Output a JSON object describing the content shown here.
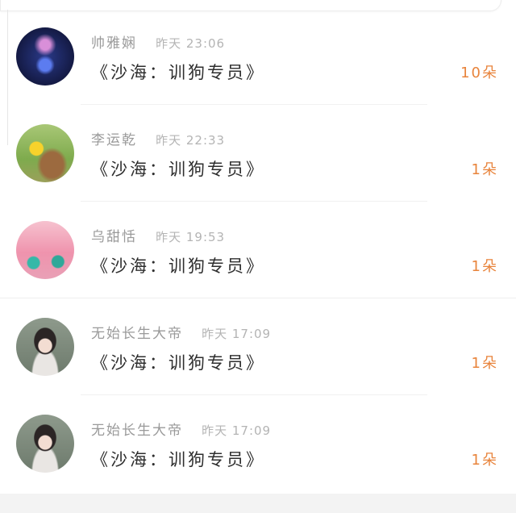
{
  "list": {
    "items": [
      {
        "name": "帅雅娴",
        "time": "昨天 23:06",
        "title": "《沙海：训狗专员》",
        "count": "10朵"
      },
      {
        "name": "李运乾",
        "time": "昨天 22:33",
        "title": "《沙海：训狗专员》",
        "count": "1朵"
      },
      {
        "name": "乌甜恬",
        "time": "昨天 19:53",
        "title": "《沙海：训狗专员》",
        "count": "1朵"
      },
      {
        "name": "无始长生大帝",
        "time": "昨天 17:09",
        "title": "《沙海：训狗专员》",
        "count": "1朵"
      },
      {
        "name": "无始长生大帝",
        "time": "昨天 17:09",
        "title": "《沙海：训狗专员》",
        "count": "1朵"
      }
    ]
  },
  "colors": {
    "count_accent": "#e8843c",
    "name_text": "#9a9a9a",
    "title_text": "#2e2e2e"
  }
}
